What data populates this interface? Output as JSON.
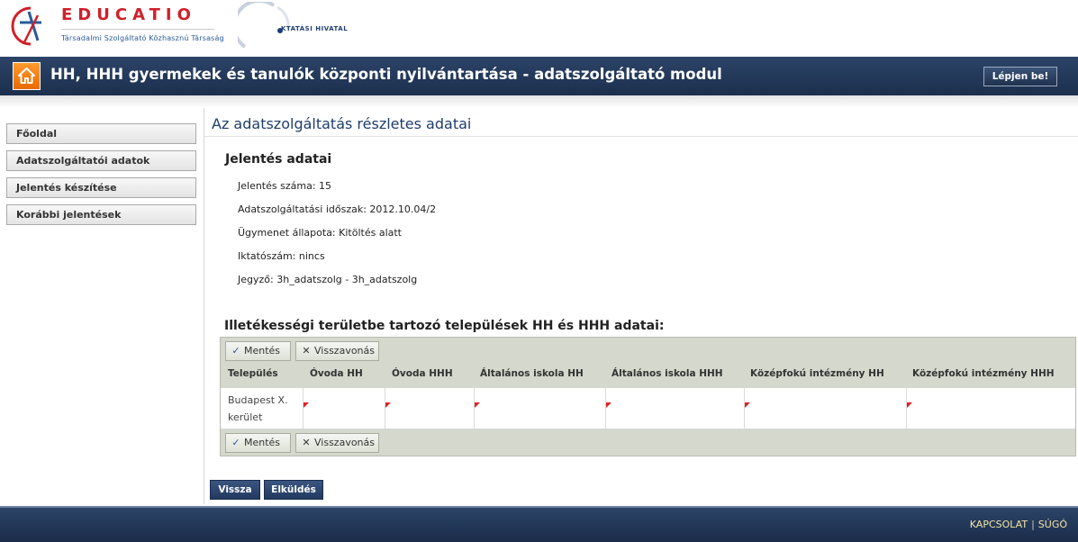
{
  "brand": {
    "educatio_title": "EDUCATIO",
    "educatio_subtitle": "Társadalmi Szolgáltató Közhasznú Társaság",
    "oktatasi_hivatal": "KTATÁSI HIVATAL"
  },
  "header": {
    "title": "HH, HHH gyermekek és tanulók központi nyilvántartása - adatszolgáltató modul",
    "login_label": "Lépjen be!",
    "home_icon": "home-icon"
  },
  "sidebar": {
    "items": [
      {
        "label": "Főoldal"
      },
      {
        "label": "Adatszolgáltatói adatok"
      },
      {
        "label": "Jelentés készítése"
      },
      {
        "label": "Korábbi jelentések"
      }
    ]
  },
  "main": {
    "page_title": "Az adatszolgáltatás részletes adatai",
    "section_title": "Jelentés adatai",
    "fields": [
      {
        "label": "Jelentés száma:",
        "value": "15"
      },
      {
        "label": "Adatszolgáltatási időszak:",
        "value": "2012.10.04/2"
      },
      {
        "label": "Ügymenet állapota:",
        "value": "Kitöltés alatt"
      },
      {
        "label": "Iktatószám:",
        "value": "nincs"
      },
      {
        "label": "Jegyző:",
        "value": "3h_adatszolg - 3h_adatszolg"
      }
    ],
    "grid_title": "Illetékességi területbe tartozó települések HH és HHH adatai:",
    "save_label": "Mentés",
    "revert_label": "Visszavonás",
    "columns": [
      "Település",
      "Óvoda HH",
      "Óvoda HHH",
      "Általános iskola HH",
      "Általános iskola HHH",
      "Középfokú intézmény HH",
      "Középfokú intézmény HHH"
    ],
    "rows": [
      {
        "town_line1": "Budapest X.",
        "town_line2": "kerület",
        "values": [
          "",
          "",
          "",
          "",
          "",
          ""
        ]
      }
    ],
    "back_label": "Vissza",
    "send_label": "Elküldés"
  },
  "footer": {
    "contact_label": "KAPCSOLAT",
    "separator": "|",
    "help_label": "SÚGÓ"
  },
  "colors": {
    "header_bg": "#22395b",
    "accent_orange": "#f08a1c",
    "title_blue": "#1f3d6a",
    "grid_panel": "#d4d8cd",
    "dirty_flag": "#e02020"
  }
}
